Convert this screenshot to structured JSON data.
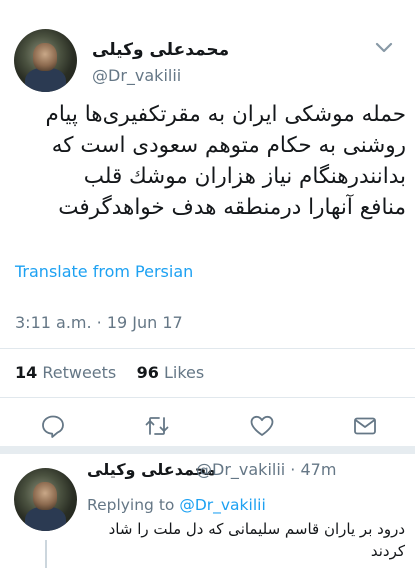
{
  "tweet": {
    "display_name": "محمدعلی وکیلی",
    "handle": "@Dr_vakilii",
    "text_lines": [
      "حمله موشکی ایران به مقرتکفیری‌ها پیام",
      "روشنی به حکام متوهم سعودی است که",
      "بدانندرهنگام نیاز هزاران موشك قلب",
      "منافع آنهارا درمنطقه هدف خواهدگرفت"
    ],
    "translate_label": "Translate from Persian",
    "timestamp": "3:11 a.m. · 19 Jun 17",
    "retweets_count": "14",
    "retweets_label": "Retweets",
    "likes_count": "96",
    "likes_label": "Likes"
  },
  "actions": {
    "icons": [
      "reply-icon",
      "retweet-icon",
      "like-icon",
      "dm-icon"
    ]
  },
  "reply": {
    "display_name": "محمدعلی وکیلی",
    "handle_time": "@Dr_vakilii · 47m",
    "replying_prefix": "Replying to",
    "replying_handle": "@Dr_vakilii",
    "text": "درود بر یاران قاسم سلیمانی که دل ملت را شاد کردند"
  },
  "colors": {
    "link": "#1da1f2",
    "secondary": "#657786",
    "text": "#14171a",
    "divider": "#e1e8ed"
  }
}
